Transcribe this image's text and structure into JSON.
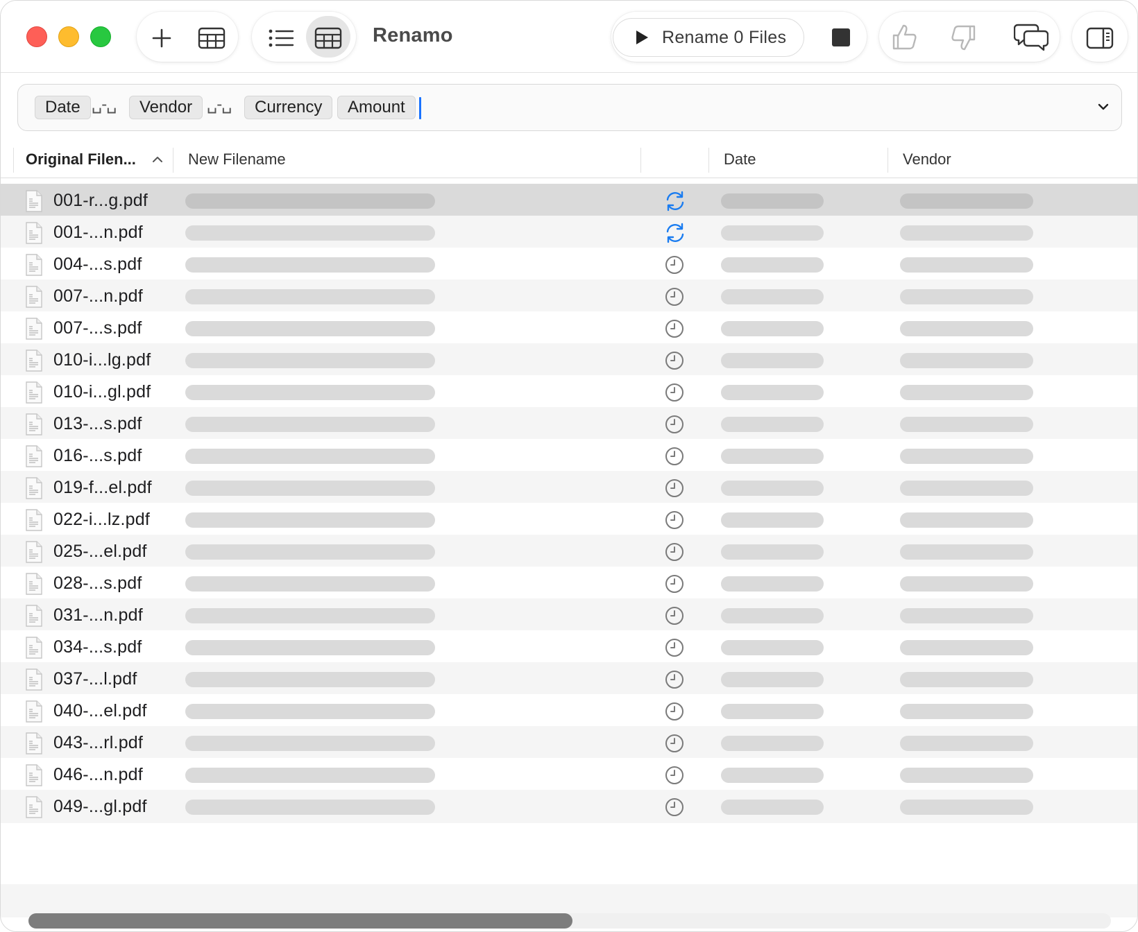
{
  "app": {
    "title": "Renamo"
  },
  "toolbar": {
    "rename_label": "Rename 0 Files",
    "icons": [
      "plus-icon",
      "table-icon",
      "list-view-icon",
      "grid-view-icon",
      "play-icon",
      "stop-icon",
      "thumbs-up-icon",
      "thumbs-down-icon",
      "chat-bubbles-icon",
      "sidebar-icon"
    ]
  },
  "pattern": {
    "tokens": [
      "Date",
      "Vendor",
      "Currency",
      "Amount"
    ],
    "separator": "␣-␣"
  },
  "table": {
    "columns": {
      "original": "Original Filen...",
      "new": "New Filename",
      "status": "",
      "date": "Date",
      "vendor": "Vendor"
    },
    "rows": [
      {
        "name": "001-r...g.pdf",
        "status": "processing",
        "selected": true
      },
      {
        "name": "001-...n.pdf",
        "status": "processing"
      },
      {
        "name": "004-...s.pdf",
        "status": "pending"
      },
      {
        "name": "007-...n.pdf",
        "status": "pending"
      },
      {
        "name": "007-...s.pdf",
        "status": "pending"
      },
      {
        "name": "010-i...lg.pdf",
        "status": "pending"
      },
      {
        "name": "010-i...gl.pdf",
        "status": "pending"
      },
      {
        "name": "013-...s.pdf",
        "status": "pending"
      },
      {
        "name": "016-...s.pdf",
        "status": "pending"
      },
      {
        "name": "019-f...el.pdf",
        "status": "pending"
      },
      {
        "name": "022-i...lz.pdf",
        "status": "pending"
      },
      {
        "name": "025-...el.pdf",
        "status": "pending"
      },
      {
        "name": "028-...s.pdf",
        "status": "pending"
      },
      {
        "name": "031-...n.pdf",
        "status": "pending"
      },
      {
        "name": "034-...s.pdf",
        "status": "pending"
      },
      {
        "name": "037-...l.pdf",
        "status": "pending"
      },
      {
        "name": "040-...el.pdf",
        "status": "pending"
      },
      {
        "name": "043-...rl.pdf",
        "status": "pending"
      },
      {
        "name": "046-...n.pdf",
        "status": "pending"
      },
      {
        "name": "049-...gl.pdf",
        "status": "pending"
      }
    ]
  },
  "colors": {
    "accent": "#1a73ff",
    "processing": "#1a7cf0",
    "pending": "#7a7a7a"
  }
}
